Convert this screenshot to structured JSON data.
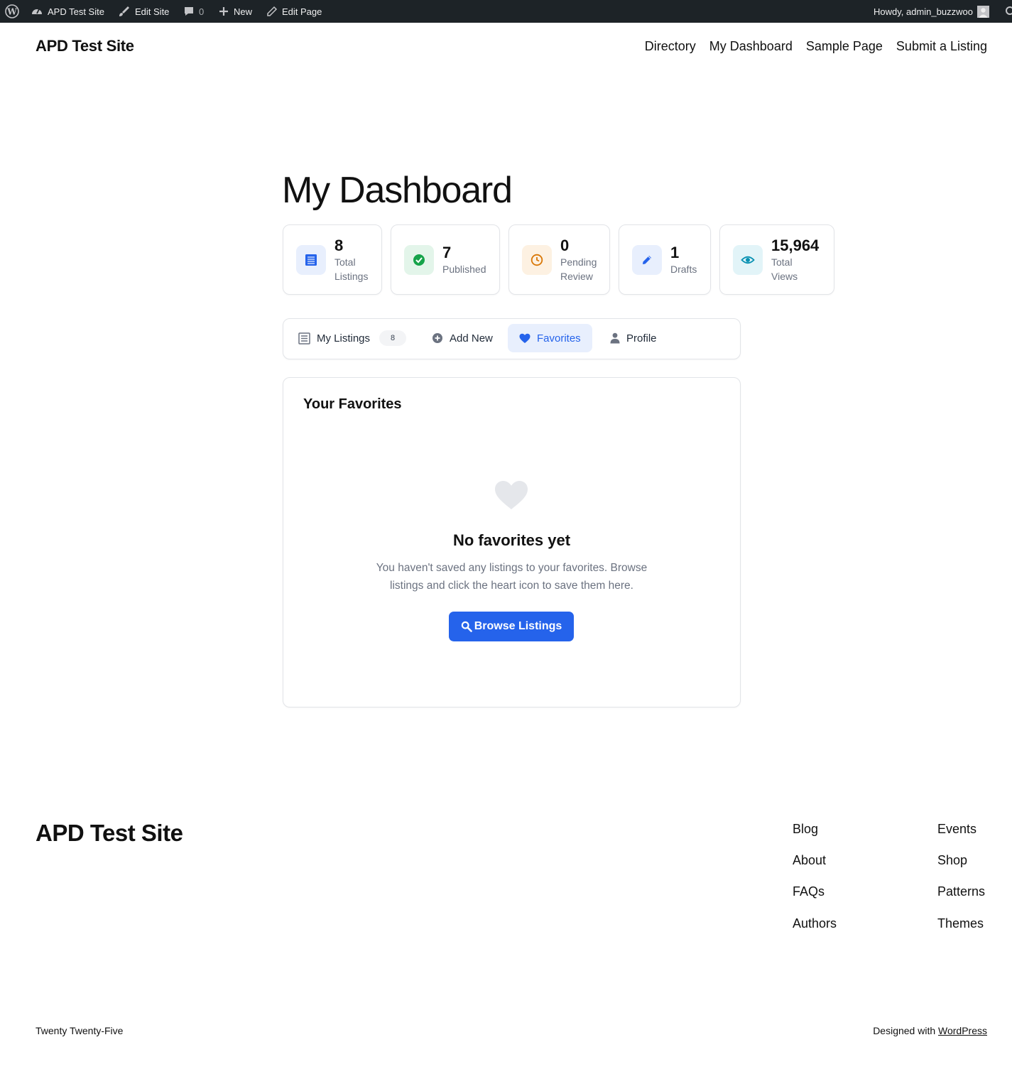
{
  "admin_bar": {
    "site_name": "APD Test Site",
    "edit_site": "Edit Site",
    "comments_count": "0",
    "new_label": "New",
    "edit_page": "Edit Page",
    "howdy": "Howdy, admin_buzzwoo"
  },
  "header": {
    "site_title": "APD Test Site",
    "nav": [
      "Directory",
      "My Dashboard",
      "Sample Page",
      "Submit a Listing"
    ]
  },
  "page": {
    "title": "My Dashboard"
  },
  "stats": [
    {
      "value": "8",
      "label_line1": "Total",
      "label_line2": "Listings",
      "icon": "list-icon",
      "color": "#2563eb",
      "bg": "#e8effd"
    },
    {
      "value": "7",
      "label_line1": "Published",
      "label_line2": "",
      "icon": "check-circle-icon",
      "color": "#16a34a",
      "bg": "#e3f5ea"
    },
    {
      "value": "0",
      "label_line1": "Pending",
      "label_line2": "Review",
      "icon": "clock-icon",
      "color": "#d97706",
      "bg": "#fdf1e2"
    },
    {
      "value": "1",
      "label_line1": "Drafts",
      "label_line2": "",
      "icon": "pencil-icon",
      "color": "#2563eb",
      "bg": "#e8effd"
    },
    {
      "value": "15,964",
      "label_line1": "Total",
      "label_line2": "Views",
      "icon": "eye-icon",
      "color": "#0891b2",
      "bg": "#e2f4f8"
    }
  ],
  "tabs": {
    "my_listings": "My Listings",
    "my_listings_count": "8",
    "add_new": "Add New",
    "favorites": "Favorites",
    "profile": "Profile",
    "active": "favorites"
  },
  "favorites_panel": {
    "title": "Your Favorites",
    "empty_title": "No favorites yet",
    "empty_text": "You haven't saved any listings to your favorites. Browse listings and click the heart icon to save them here.",
    "button_label": "Browse Listings"
  },
  "footer": {
    "site_title": "APD Test Site",
    "links_col1": [
      "Blog",
      "About",
      "FAQs",
      "Authors"
    ],
    "links_col2": [
      "Events",
      "Shop",
      "Patterns",
      "Themes"
    ],
    "theme_name": "Twenty Twenty-Five",
    "designed_with": "Designed with",
    "designed_with_link": "WordPress"
  },
  "colors": {
    "accent": "#2563eb",
    "admin_bar_bg": "#1d2327"
  }
}
